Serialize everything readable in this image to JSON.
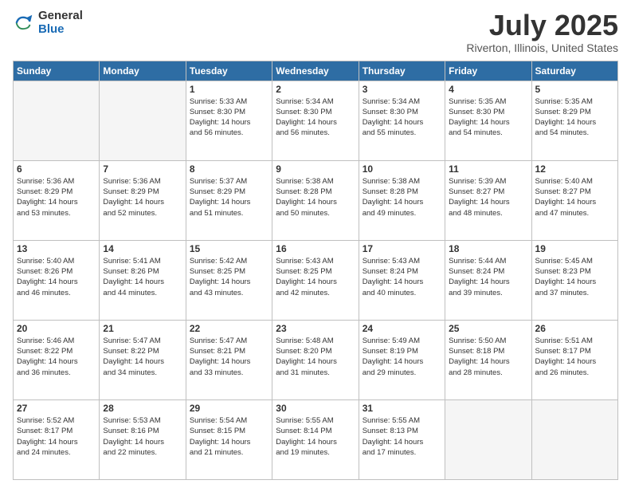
{
  "logo": {
    "general": "General",
    "blue": "Blue"
  },
  "title": "July 2025",
  "subtitle": "Riverton, Illinois, United States",
  "headers": [
    "Sunday",
    "Monday",
    "Tuesday",
    "Wednesday",
    "Thursday",
    "Friday",
    "Saturday"
  ],
  "weeks": [
    [
      {
        "day": "",
        "detail": ""
      },
      {
        "day": "",
        "detail": ""
      },
      {
        "day": "1",
        "detail": "Sunrise: 5:33 AM\nSunset: 8:30 PM\nDaylight: 14 hours\nand 56 minutes."
      },
      {
        "day": "2",
        "detail": "Sunrise: 5:34 AM\nSunset: 8:30 PM\nDaylight: 14 hours\nand 56 minutes."
      },
      {
        "day": "3",
        "detail": "Sunrise: 5:34 AM\nSunset: 8:30 PM\nDaylight: 14 hours\nand 55 minutes."
      },
      {
        "day": "4",
        "detail": "Sunrise: 5:35 AM\nSunset: 8:30 PM\nDaylight: 14 hours\nand 54 minutes."
      },
      {
        "day": "5",
        "detail": "Sunrise: 5:35 AM\nSunset: 8:29 PM\nDaylight: 14 hours\nand 54 minutes."
      }
    ],
    [
      {
        "day": "6",
        "detail": "Sunrise: 5:36 AM\nSunset: 8:29 PM\nDaylight: 14 hours\nand 53 minutes."
      },
      {
        "day": "7",
        "detail": "Sunrise: 5:36 AM\nSunset: 8:29 PM\nDaylight: 14 hours\nand 52 minutes."
      },
      {
        "day": "8",
        "detail": "Sunrise: 5:37 AM\nSunset: 8:29 PM\nDaylight: 14 hours\nand 51 minutes."
      },
      {
        "day": "9",
        "detail": "Sunrise: 5:38 AM\nSunset: 8:28 PM\nDaylight: 14 hours\nand 50 minutes."
      },
      {
        "day": "10",
        "detail": "Sunrise: 5:38 AM\nSunset: 8:28 PM\nDaylight: 14 hours\nand 49 minutes."
      },
      {
        "day": "11",
        "detail": "Sunrise: 5:39 AM\nSunset: 8:27 PM\nDaylight: 14 hours\nand 48 minutes."
      },
      {
        "day": "12",
        "detail": "Sunrise: 5:40 AM\nSunset: 8:27 PM\nDaylight: 14 hours\nand 47 minutes."
      }
    ],
    [
      {
        "day": "13",
        "detail": "Sunrise: 5:40 AM\nSunset: 8:26 PM\nDaylight: 14 hours\nand 46 minutes."
      },
      {
        "day": "14",
        "detail": "Sunrise: 5:41 AM\nSunset: 8:26 PM\nDaylight: 14 hours\nand 44 minutes."
      },
      {
        "day": "15",
        "detail": "Sunrise: 5:42 AM\nSunset: 8:25 PM\nDaylight: 14 hours\nand 43 minutes."
      },
      {
        "day": "16",
        "detail": "Sunrise: 5:43 AM\nSunset: 8:25 PM\nDaylight: 14 hours\nand 42 minutes."
      },
      {
        "day": "17",
        "detail": "Sunrise: 5:43 AM\nSunset: 8:24 PM\nDaylight: 14 hours\nand 40 minutes."
      },
      {
        "day": "18",
        "detail": "Sunrise: 5:44 AM\nSunset: 8:24 PM\nDaylight: 14 hours\nand 39 minutes."
      },
      {
        "day": "19",
        "detail": "Sunrise: 5:45 AM\nSunset: 8:23 PM\nDaylight: 14 hours\nand 37 minutes."
      }
    ],
    [
      {
        "day": "20",
        "detail": "Sunrise: 5:46 AM\nSunset: 8:22 PM\nDaylight: 14 hours\nand 36 minutes."
      },
      {
        "day": "21",
        "detail": "Sunrise: 5:47 AM\nSunset: 8:22 PM\nDaylight: 14 hours\nand 34 minutes."
      },
      {
        "day": "22",
        "detail": "Sunrise: 5:47 AM\nSunset: 8:21 PM\nDaylight: 14 hours\nand 33 minutes."
      },
      {
        "day": "23",
        "detail": "Sunrise: 5:48 AM\nSunset: 8:20 PM\nDaylight: 14 hours\nand 31 minutes."
      },
      {
        "day": "24",
        "detail": "Sunrise: 5:49 AM\nSunset: 8:19 PM\nDaylight: 14 hours\nand 29 minutes."
      },
      {
        "day": "25",
        "detail": "Sunrise: 5:50 AM\nSunset: 8:18 PM\nDaylight: 14 hours\nand 28 minutes."
      },
      {
        "day": "26",
        "detail": "Sunrise: 5:51 AM\nSunset: 8:17 PM\nDaylight: 14 hours\nand 26 minutes."
      }
    ],
    [
      {
        "day": "27",
        "detail": "Sunrise: 5:52 AM\nSunset: 8:17 PM\nDaylight: 14 hours\nand 24 minutes."
      },
      {
        "day": "28",
        "detail": "Sunrise: 5:53 AM\nSunset: 8:16 PM\nDaylight: 14 hours\nand 22 minutes."
      },
      {
        "day": "29",
        "detail": "Sunrise: 5:54 AM\nSunset: 8:15 PM\nDaylight: 14 hours\nand 21 minutes."
      },
      {
        "day": "30",
        "detail": "Sunrise: 5:55 AM\nSunset: 8:14 PM\nDaylight: 14 hours\nand 19 minutes."
      },
      {
        "day": "31",
        "detail": "Sunrise: 5:55 AM\nSunset: 8:13 PM\nDaylight: 14 hours\nand 17 minutes."
      },
      {
        "day": "",
        "detail": ""
      },
      {
        "day": "",
        "detail": ""
      }
    ]
  ]
}
